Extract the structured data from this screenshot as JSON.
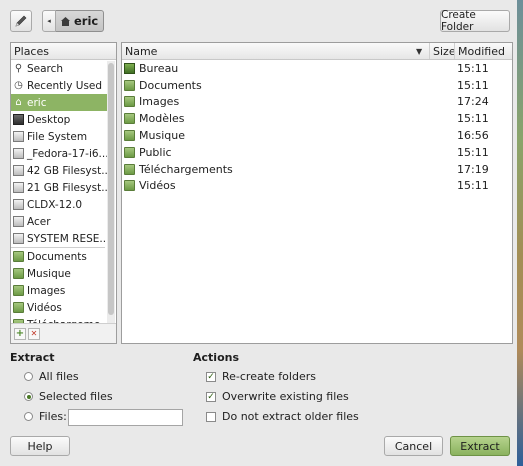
{
  "toolbar": {
    "edit_icon": "pencil-icon",
    "path": {
      "arrow": "◂",
      "home_icon": "home-icon",
      "current": "eric"
    },
    "create_folder_label": "Create Folder"
  },
  "places": {
    "header": "Places",
    "items": [
      {
        "label": "Search",
        "icon": "search-icon"
      },
      {
        "label": "Recently Used",
        "icon": "clock-icon"
      },
      {
        "label": "eric",
        "icon": "home-icon",
        "selected": true
      },
      {
        "label": "Desktop",
        "icon": "desktop-icon"
      },
      {
        "label": "File System",
        "icon": "drive-icon"
      },
      {
        "label": "_Fedora-17-i6...",
        "icon": "drive-icon"
      },
      {
        "label": "42 GB Filesyst...",
        "icon": "drive-icon"
      },
      {
        "label": "21 GB Filesyst...",
        "icon": "drive-icon"
      },
      {
        "label": "CLDX-12.0",
        "icon": "drive-icon"
      },
      {
        "label": "Acer",
        "icon": "drive-icon"
      },
      {
        "label": "SYSTEM RESE...",
        "icon": "drive-icon"
      },
      {
        "label": "Documents",
        "icon": "folder-icon"
      },
      {
        "label": "Musique",
        "icon": "folder-icon"
      },
      {
        "label": "Images",
        "icon": "folder-icon"
      },
      {
        "label": "Vidéos",
        "icon": "folder-icon"
      },
      {
        "label": "Téléchargeme...",
        "icon": "folder-icon"
      }
    ],
    "add_label": "+",
    "remove_label": "✕"
  },
  "files": {
    "columns": {
      "name": "Name",
      "size": "Size",
      "modified": "Modified"
    },
    "rows": [
      {
        "name": "Bureau",
        "modified": "15:11",
        "icon": "desktop-folder-icon"
      },
      {
        "name": "Documents",
        "modified": "15:11",
        "icon": "folder-icon"
      },
      {
        "name": "Images",
        "modified": "17:24",
        "icon": "folder-icon"
      },
      {
        "name": "Modèles",
        "modified": "15:11",
        "icon": "folder-icon"
      },
      {
        "name": "Musique",
        "modified": "16:56",
        "icon": "folder-icon"
      },
      {
        "name": "Public",
        "modified": "15:11",
        "icon": "folder-icon"
      },
      {
        "name": "Téléchargements",
        "modified": "17:19",
        "icon": "folder-icon"
      },
      {
        "name": "Vidéos",
        "modified": "15:11",
        "icon": "folder-icon"
      }
    ]
  },
  "extract": {
    "title": "Extract",
    "all_files": "All files",
    "selected_files": "Selected files",
    "files_label": "Files:",
    "files_value": "",
    "selected_option": "selected_files"
  },
  "actions": {
    "title": "Actions",
    "recreate_folders": {
      "label": "Re-create folders",
      "checked": true
    },
    "overwrite_existing": {
      "label": "Overwrite existing files",
      "checked": true
    },
    "do_not_extract_older": {
      "label": "Do not extract older files",
      "checked": false
    }
  },
  "buttons": {
    "help": "Help",
    "cancel": "Cancel",
    "extract": "Extract"
  },
  "colors": {
    "accent": "#8db464",
    "extract_button": "#9dc172"
  }
}
